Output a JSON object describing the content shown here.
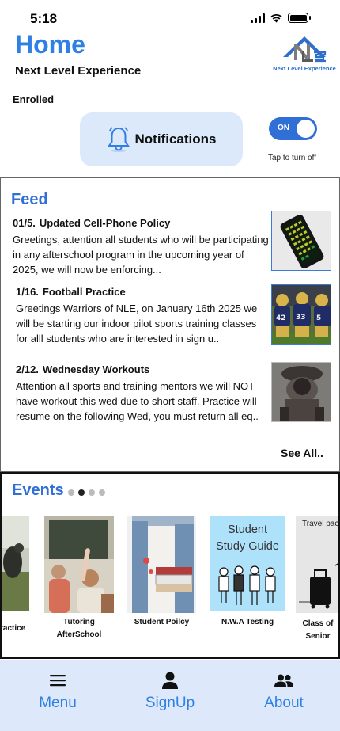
{
  "status_bar": {
    "time": "5:18"
  },
  "header": {
    "title": "Home",
    "subtitle": "Next Level Experience",
    "logo_caption": "Next Level Experience"
  },
  "enrollment": {
    "status": "Enrolled"
  },
  "notifications": {
    "button_label": "Notifications",
    "toggle_state": "ON",
    "toggle_caption": "Tap to turn off"
  },
  "feed": {
    "title": "Feed",
    "see_all": "See All..",
    "items": [
      {
        "date": "01/5.",
        "title": "Updated Cell-Phone Policy",
        "body": "Greetings, attention all students who will be participating in any afterschool program in the upcoming year of 2025, we will now be enforcing..."
      },
      {
        "date": "1/16.",
        "title": "Football Practice",
        "body": "Greetings Warriors of NLE, on January 16th 2025 we will be starting our indoor pilot sports training classes for alll students who are interested in sign u.."
      },
      {
        "date": "2/12.",
        "title": "Wednesday Workouts",
        "body": "Attention all sports and training mentors we will NOT have workout this wed due to short staff. Practice will resume on the following Wed, you must return all eq.."
      }
    ]
  },
  "events": {
    "title": "Events",
    "active_page": 2,
    "page_count": 4,
    "cards": [
      {
        "label": "ractice"
      },
      {
        "label": "Tutoring AfterSchool"
      },
      {
        "label": "Student Poilcy"
      },
      {
        "label": "N.W.A Testing",
        "image_text": "Student Study Guide"
      },
      {
        "label": "Class of Senior",
        "image_text": "Travel pac"
      }
    ]
  },
  "bottom_nav": {
    "items": [
      {
        "label": "Menu",
        "icon": "hamburger-icon"
      },
      {
        "label": "SignUp",
        "icon": "person-icon"
      },
      {
        "label": "About",
        "icon": "group-icon"
      }
    ]
  },
  "colors": {
    "accent": "#2f80e4",
    "nav_background": "#dde9fb",
    "notification_button": "#dce9fb",
    "toggle_on": "#2f6fd6"
  }
}
